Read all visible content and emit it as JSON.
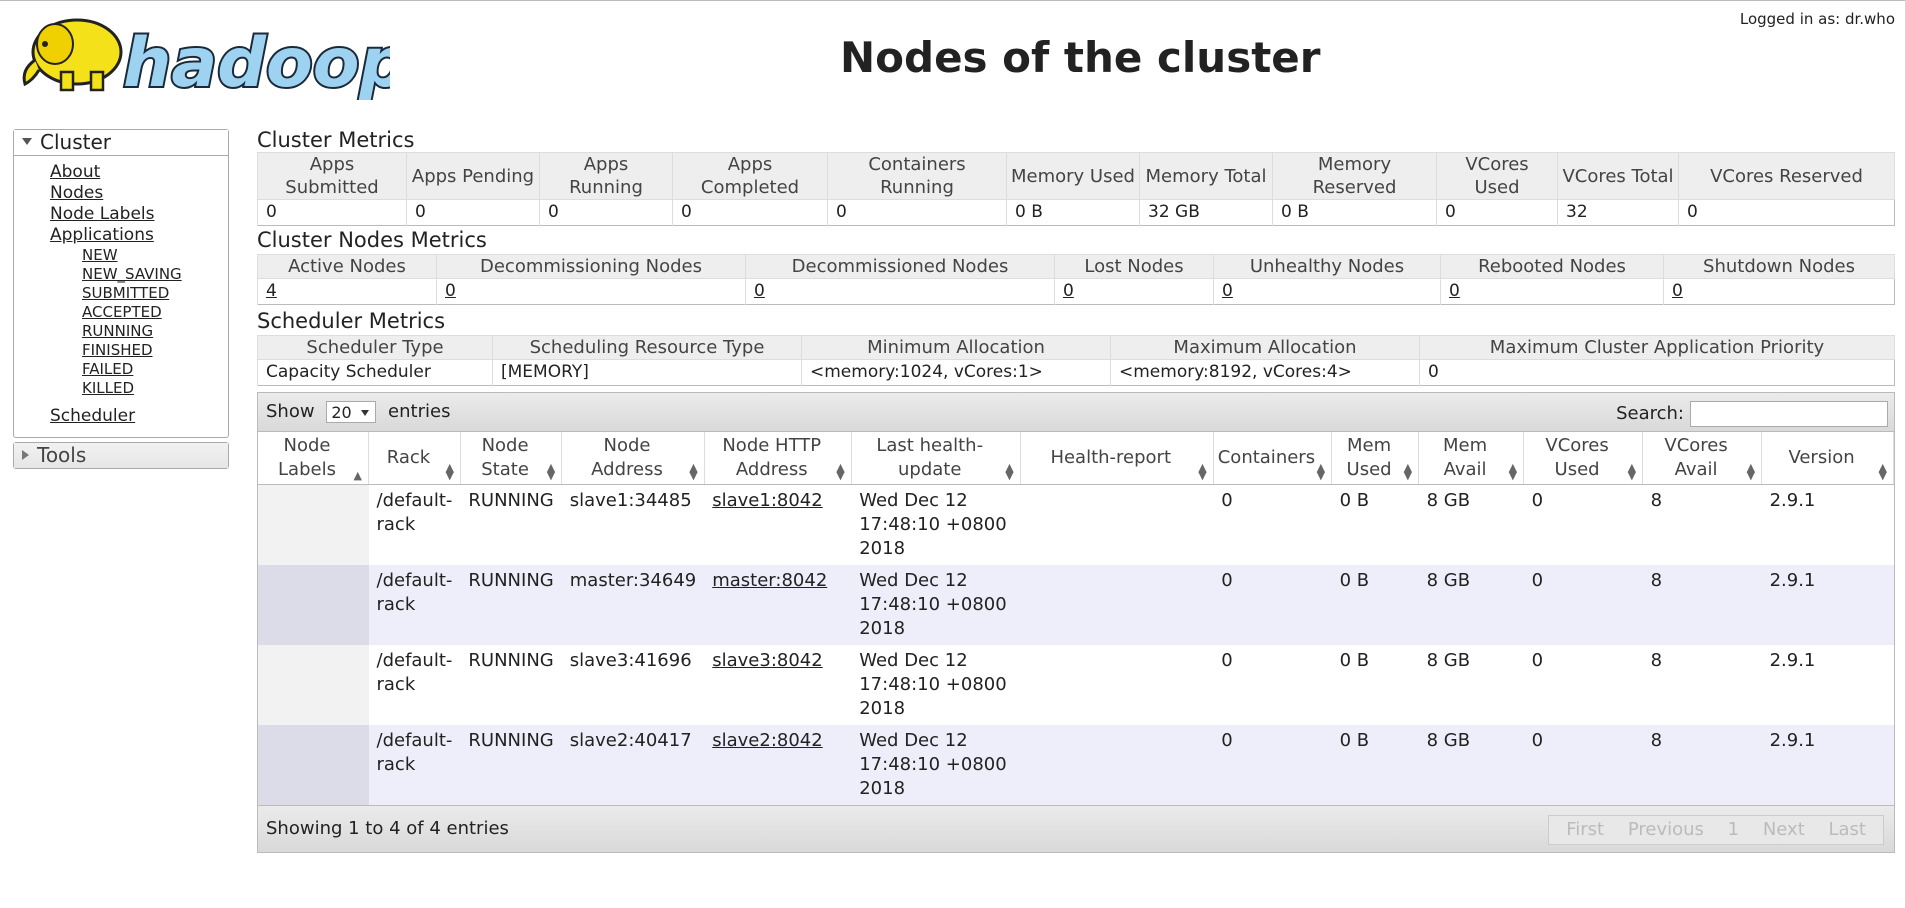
{
  "header": {
    "logo_text": "hadoop",
    "logged_in": "Logged in as: dr.who",
    "title": "Nodes of the cluster"
  },
  "sidebar": {
    "cluster_label": "Cluster",
    "cluster_links": [
      "About",
      "Nodes",
      "Node Labels",
      "Applications"
    ],
    "app_states": [
      "NEW",
      "NEW_SAVING",
      "SUBMITTED",
      "ACCEPTED",
      "RUNNING",
      "FINISHED",
      "FAILED",
      "KILLED"
    ],
    "scheduler": "Scheduler",
    "tools_label": "Tools"
  },
  "cluster_metrics": {
    "title": "Cluster Metrics",
    "headers": [
      "Apps Submitted",
      "Apps Pending",
      "Apps Running",
      "Apps Completed",
      "Containers Running",
      "Memory Used",
      "Memory Total",
      "Memory Reserved",
      "VCores Used",
      "VCores Total",
      "VCores Reserved"
    ],
    "values": [
      "0",
      "0",
      "0",
      "0",
      "0",
      "0 B",
      "32 GB",
      "0 B",
      "0",
      "32",
      "0"
    ]
  },
  "node_metrics": {
    "title": "Cluster Nodes Metrics",
    "headers": [
      "Active Nodes",
      "Decommissioning Nodes",
      "Decommissioned Nodes",
      "Lost Nodes",
      "Unhealthy Nodes",
      "Rebooted Nodes",
      "Shutdown Nodes"
    ],
    "values": [
      "4",
      "0",
      "0",
      "0",
      "0",
      "0",
      "0"
    ]
  },
  "scheduler_metrics": {
    "title": "Scheduler Metrics",
    "headers": [
      "Scheduler Type",
      "Scheduling Resource Type",
      "Minimum Allocation",
      "Maximum Allocation",
      "Maximum Cluster Application Priority"
    ],
    "values": [
      "Capacity Scheduler",
      "[MEMORY]",
      "<memory:1024, vCores:1>",
      "<memory:8192, vCores:4>",
      "0"
    ]
  },
  "nodes_table": {
    "show_label": "Show",
    "entries_value": "20",
    "entries_label": "entries",
    "search_label": "Search:",
    "search_value": "",
    "columns": [
      "Node Labels",
      "Rack",
      "Node State",
      "Node Address",
      "Node HTTP Address",
      "Last health-update",
      "Health-report",
      "Containers",
      "Mem Used",
      "Mem Avail",
      "VCores Used",
      "VCores Avail",
      "Version"
    ],
    "rows": [
      [
        "",
        "/default-rack",
        "RUNNING",
        "slave1:34485",
        "slave1:8042",
        "Wed Dec 12 17:48:10 +0800 2018",
        "",
        "0",
        "0 B",
        "8 GB",
        "0",
        "8",
        "2.9.1"
      ],
      [
        "",
        "/default-rack",
        "RUNNING",
        "master:34649",
        "master:8042",
        "Wed Dec 12 17:48:10 +0800 2018",
        "",
        "0",
        "0 B",
        "8 GB",
        "0",
        "8",
        "2.9.1"
      ],
      [
        "",
        "/default-rack",
        "RUNNING",
        "slave3:41696",
        "slave3:8042",
        "Wed Dec 12 17:48:10 +0800 2018",
        "",
        "0",
        "0 B",
        "8 GB",
        "0",
        "8",
        "2.9.1"
      ],
      [
        "",
        "/default-rack",
        "RUNNING",
        "slave2:40417",
        "slave2:8042",
        "Wed Dec 12 17:48:10 +0800 2018",
        "",
        "0",
        "0 B",
        "8 GB",
        "0",
        "8",
        "2.9.1"
      ]
    ],
    "info": "Showing 1 to 4 of 4 entries",
    "paging": [
      "First",
      "Previous",
      "1",
      "Next",
      "Last"
    ]
  }
}
